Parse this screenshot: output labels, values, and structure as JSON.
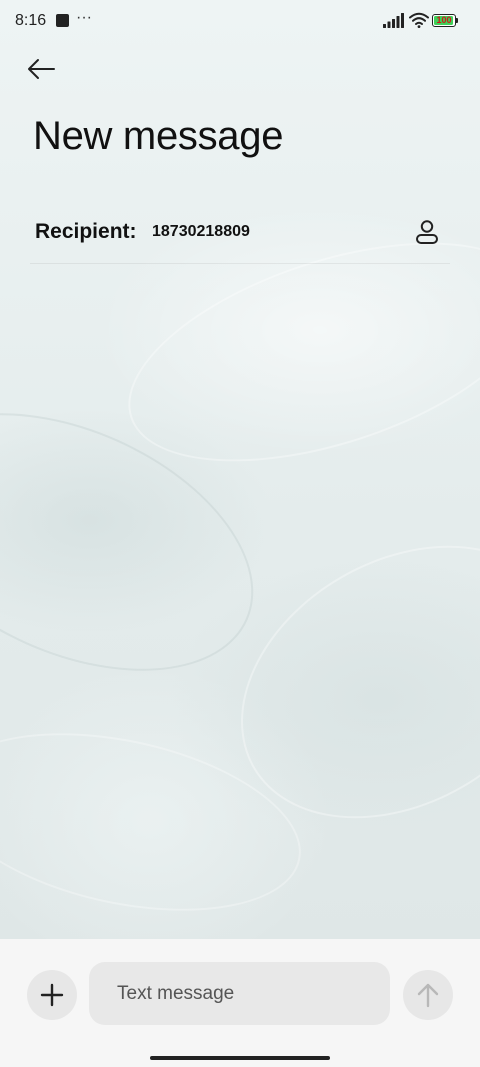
{
  "status_bar": {
    "time": "8:16",
    "more_indicator": "···",
    "battery_level": "100",
    "battery_fraction": 1.0,
    "icons": [
      "notification-square-icon",
      "signal-icon",
      "wifi-icon",
      "battery-icon"
    ],
    "battery_color": "#3fcf59",
    "battery_text_color": "#d01a1a"
  },
  "header": {
    "back_icon": "arrow-left-icon",
    "title": "New message"
  },
  "recipient": {
    "label": "Recipient:",
    "value": "18730218809",
    "contact_icon": "person-icon"
  },
  "compose": {
    "attach_icon": "plus-icon",
    "placeholder": "Text message",
    "value": "",
    "send_icon": "arrow-up-icon",
    "send_enabled": false
  },
  "colors": {
    "background_top": "#eef4f4",
    "background_bottom": "#dde5e5",
    "compose_bar": "#f6f6f6",
    "button_fill": "#e7e7e7",
    "send_icon_disabled": "#b8b8b8"
  }
}
